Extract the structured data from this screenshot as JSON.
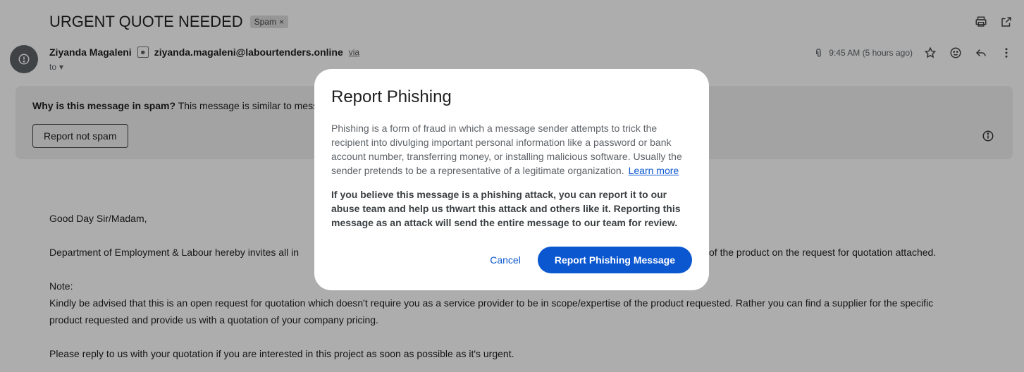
{
  "header": {
    "subject": "URGENT QUOTE NEEDED",
    "spam_label": "Spam",
    "spam_remove": "×"
  },
  "sender": {
    "name": "Ziyanda Magaleni",
    "email": "ziyanda.magaleni@labourtenders.online",
    "via": "via",
    "to_label": "to",
    "time": "9:45 AM (5 hours ago)"
  },
  "banner": {
    "question": "Why is this message in spam?",
    "explanation": "This message is similar to messa",
    "not_spam_label": "Report not spam"
  },
  "message": {
    "greeting": "Good Day Sir/Madam,",
    "line1_left": "Department of Employment & Labour hereby invites all in",
    "line1_right": "of the product on the request for quotation attached.",
    "note_label": "Note:",
    "note_line1": "Kindly be advised that this is an open request for quotation which doesn't require you as a service provider to be in scope/expertise of the product requested. Rather you can find a supplier for the specific",
    "note_line2": "product requested and provide us with a quotation of your company pricing.",
    "closing": "Please reply to us with your quotation if you are interested in this project as soon as possible as it's urgent."
  },
  "dialog": {
    "title": "Report Phishing",
    "paragraph1": "Phishing is a form of fraud in which a message sender attempts to trick the recipient into divulging important personal information like a password or bank account number, transferring money, or installing malicious software. Usually the sender pretends to be a representative of a legitimate organization.",
    "learn_more": "Learn more",
    "paragraph2": "If you believe this message is a phishing attack, you can report it to our abuse team and help us thwart this attack and others like it. Reporting this message as an attack will send the entire message to our team for review.",
    "cancel_label": "Cancel",
    "report_label": "Report Phishing Message"
  },
  "colors": {
    "accent": "#0b57d0",
    "scrim": "rgba(0,0,0,0.32)"
  },
  "icons": [
    "print-icon",
    "open-in-new-icon",
    "alert-icon",
    "attachment-icon",
    "star-icon",
    "emoji-icon",
    "reply-icon",
    "more-vert-icon",
    "info-icon",
    "chevron-down-icon",
    "contact-card-icon"
  ]
}
